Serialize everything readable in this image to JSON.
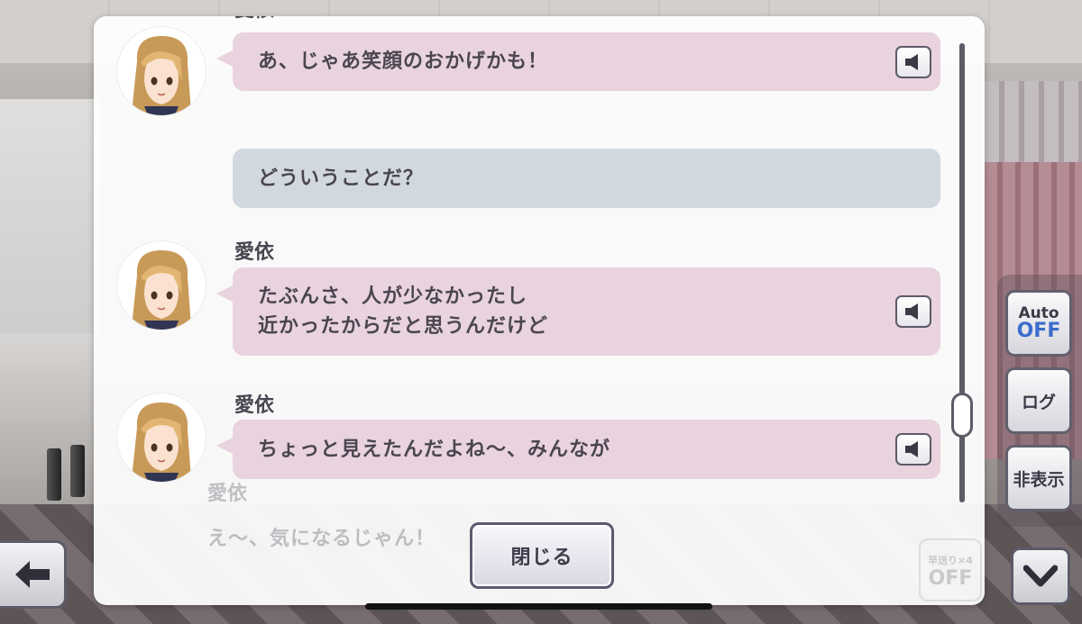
{
  "log": {
    "entries": [
      {
        "speaker": "愛依",
        "lines": [
          "あ、じゃあ笑顔のおかげかも！"
        ],
        "style": "character",
        "has_voice": true
      },
      {
        "speaker": "",
        "lines": [
          "どういうことだ？"
        ],
        "style": "player",
        "has_voice": false
      },
      {
        "speaker": "愛依",
        "lines": [
          "たぶんさ、人が少なかったし",
          "近かったからだと思うんだけど"
        ],
        "style": "character",
        "has_voice": true
      },
      {
        "speaker": "愛依",
        "lines": [
          "ちょっと見えたんだよね〜、みんなが"
        ],
        "style": "character",
        "has_voice": true
      }
    ],
    "close_label": "閉じる"
  },
  "background_message": {
    "speaker": "愛依",
    "text": "え〜、気になるじゃん！",
    "speed_label": "早送り×4",
    "speed_value": "OFF"
  },
  "controls": {
    "auto_label": "Auto",
    "auto_state": "OFF",
    "log_label": "ログ",
    "hide_label": "非表示"
  },
  "icons": {
    "back": "arrow-left-icon",
    "down": "chevron-down-icon",
    "voice": "speaker-icon"
  },
  "colors": {
    "character_bubble": "#e9d3df",
    "player_bubble": "#d2d8df",
    "auto_off": "#3c6dcc",
    "text": "#4a4650"
  }
}
